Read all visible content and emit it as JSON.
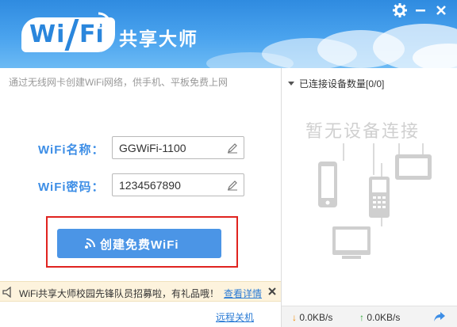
{
  "header": {
    "logo_wi": "Wi",
    "logo_fi": "Fi",
    "app_title": "共享大师",
    "settings_icon": "gear-icon",
    "minimize_icon": "minimize-icon",
    "close_icon": "close-icon"
  },
  "left": {
    "subtitle": "通过无线网卡创建WiFi网络，供手机、平板免费上网",
    "wifi_name_label": "WiFi名称：",
    "wifi_name_value": "GGWiFi-1100",
    "wifi_password_label": "WiFi密码：",
    "wifi_password_value": "1234567890",
    "create_button_label": "创建免费WiFi",
    "notice_text": "WiFi共享大师校园先锋队员招募啦，有礼品哦！",
    "notice_link": "查看详情",
    "shutdown_link": "远程关机"
  },
  "right": {
    "device_count_label": "已连接设备数量[0/0]",
    "empty_text": "暂无设备连接"
  },
  "status": {
    "download": "0.0KB/s",
    "upload": "0.0KB/s"
  },
  "colors": {
    "brand_blue": "#3d8ee6",
    "highlight_red": "#e0231f",
    "link_blue": "#2a7bd5"
  }
}
